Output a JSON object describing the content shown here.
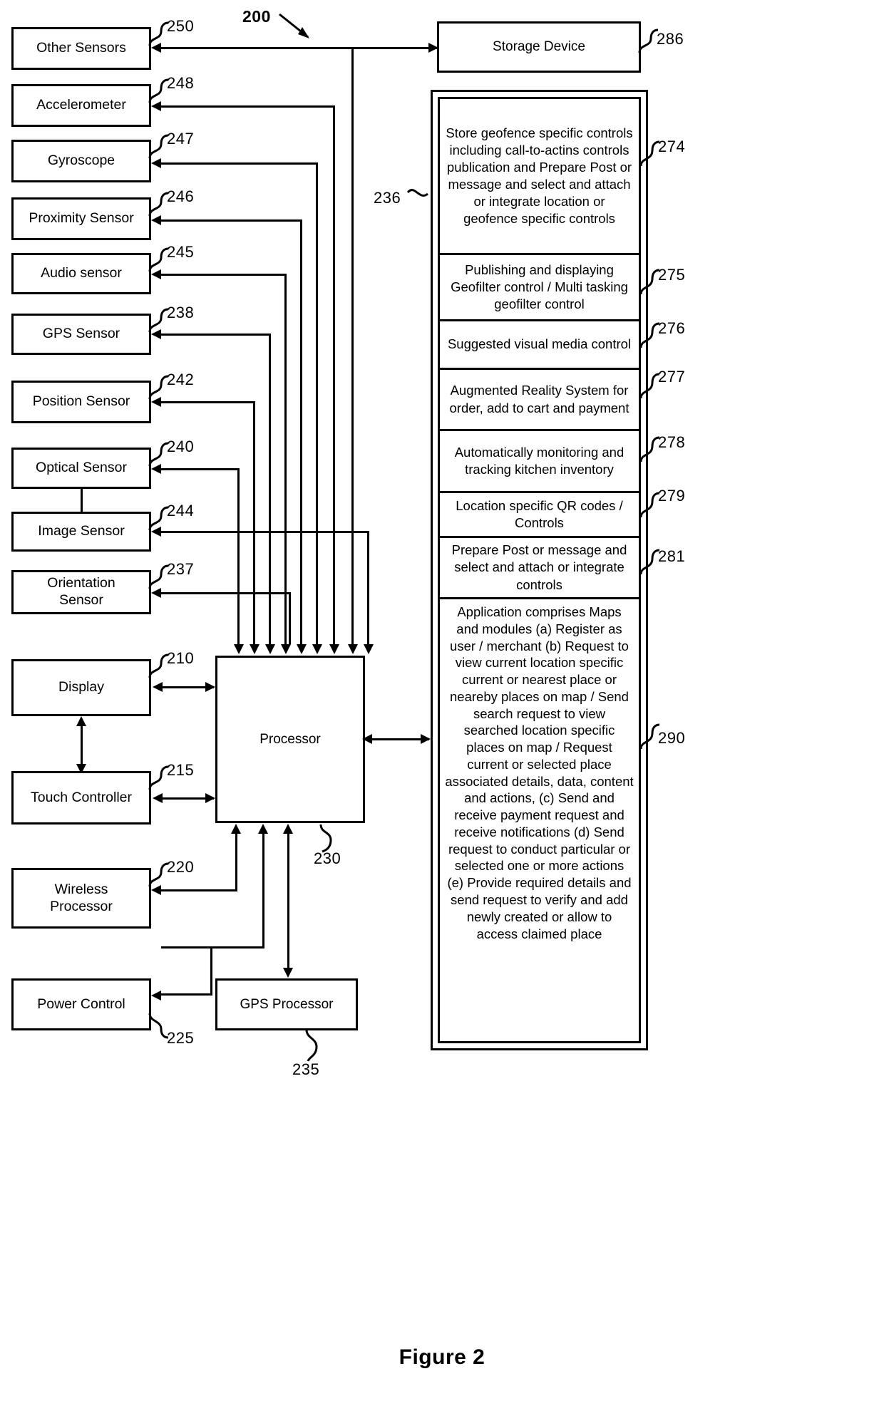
{
  "figure": {
    "caption": "Figure 2",
    "system_ref": "200"
  },
  "left_blocks": [
    {
      "label": "Other Sensors",
      "ref": "250"
    },
    {
      "label": "Accelerometer",
      "ref": "248"
    },
    {
      "label": "Gyroscope",
      "ref": "247"
    },
    {
      "label": "Proximity Sensor",
      "ref": "246"
    },
    {
      "label": "Audio sensor",
      "ref": "245"
    },
    {
      "label": "GPS Sensor",
      "ref": "238"
    },
    {
      "label": "Position Sensor",
      "ref": "242"
    },
    {
      "label": "Optical Sensor",
      "ref": "240"
    },
    {
      "label": "Image Sensor",
      "ref": "244"
    },
    {
      "label": "Orientation\nSensor",
      "ref": "237"
    },
    {
      "label": "Display",
      "ref": "210"
    },
    {
      "label": "Touch Controller",
      "ref": "215"
    },
    {
      "label": "Wireless\nProcessor",
      "ref": "220"
    },
    {
      "label": "Power Control",
      "ref": "225"
    }
  ],
  "center_blocks": [
    {
      "label": "Processor",
      "ref": "230"
    },
    {
      "label": "GPS Processor",
      "ref": "235"
    }
  ],
  "right_blocks": [
    {
      "label": "Storage Device",
      "ref": "286"
    }
  ],
  "module_container": {
    "ref": "236"
  },
  "modules": [
    {
      "ref": "274",
      "text": "Store geofence specific controls including call-to-actins controls publication and Prepare Post or message and select and attach or integrate location or geofence specific controls"
    },
    {
      "ref": "275",
      "text": "Publishing and displaying Geofilter control / Multi tasking geofilter control"
    },
    {
      "ref": "276",
      "text": "Suggested visual media control"
    },
    {
      "ref": "277",
      "text": "Augmented Reality System for order, add to cart and payment"
    },
    {
      "ref": "278",
      "text": "Automatically monitoring and tracking kitchen inventory"
    },
    {
      "ref": "279",
      "text": "Location specific QR codes / Controls"
    },
    {
      "ref": "281",
      "text": "Prepare Post or message and select and attach or integrate controls"
    },
    {
      "ref": "290",
      "text": "Application comprises Maps and modules (a) Register as user / merchant (b) Request to view current location specific current or nearest place or neareby places on map / Send search request to view searched location specific places on map / Request current or selected place  associated details, data, content and actions, (c) Send and receive payment request and receive notifications (d) Send request to conduct particular or selected one or more actions (e) Provide required details and send request to verify and add newly created  or allow to access claimed place"
    }
  ]
}
